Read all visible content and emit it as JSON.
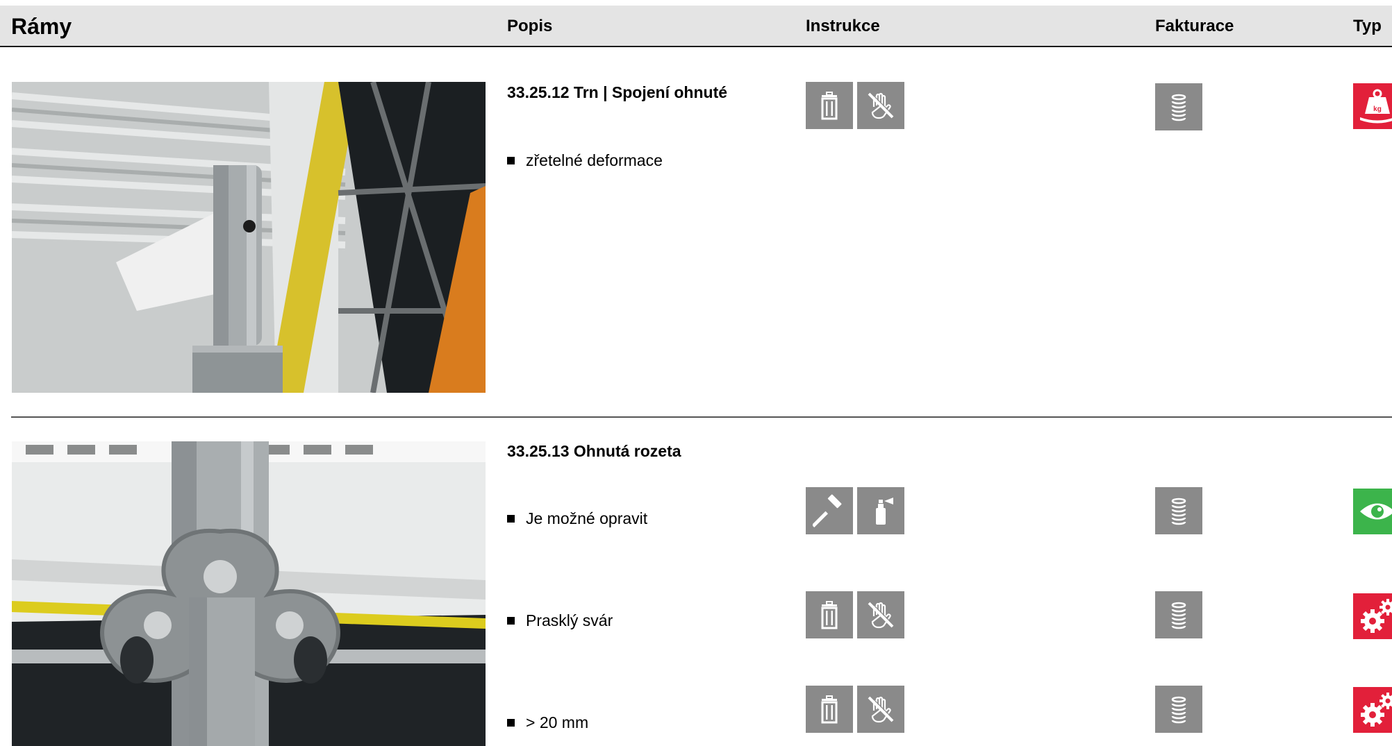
{
  "header": {
    "title": "Rámy",
    "col_popis": "Popis",
    "col_instrukce": "Instrukce",
    "col_fakturace": "Fakturace",
    "col_typ": "Typ"
  },
  "items": [
    {
      "title": "33.25.12 Trn | Spojení ohnuté",
      "rows": [
        {
          "text": "zřetelné deformace",
          "instructions": [
            "trash-icon",
            "no-touch-icon"
          ],
          "billing": "coin-stack-icon",
          "type": "weight-kg-icon",
          "type_color": "#e2203a"
        }
      ]
    },
    {
      "title": "33.25.13 Ohnutá rozeta",
      "rows": [
        {
          "text": "Je možné opravit",
          "instructions": [
            "hammer-icon",
            "spray-can-icon"
          ],
          "billing": "coin-stack-icon",
          "type": "eye-icon",
          "type_color": "#3cb44b"
        },
        {
          "text": "Prasklý svár",
          "instructions": [
            "trash-icon",
            "no-touch-icon"
          ],
          "billing": "coin-stack-icon",
          "type": "gears-icon",
          "type_color": "#e2203a"
        },
        {
          "text": "> 20 mm",
          "instructions": [
            "trash-icon",
            "no-touch-icon"
          ],
          "billing": "coin-stack-icon",
          "type": "gears-icon",
          "type_color": "#e2203a"
        }
      ]
    }
  ],
  "colors": {
    "icon_gray": "#8a8a8a",
    "header_bg": "#e4e4e4",
    "alert_red": "#e2203a",
    "ok_green": "#3cb44b"
  }
}
